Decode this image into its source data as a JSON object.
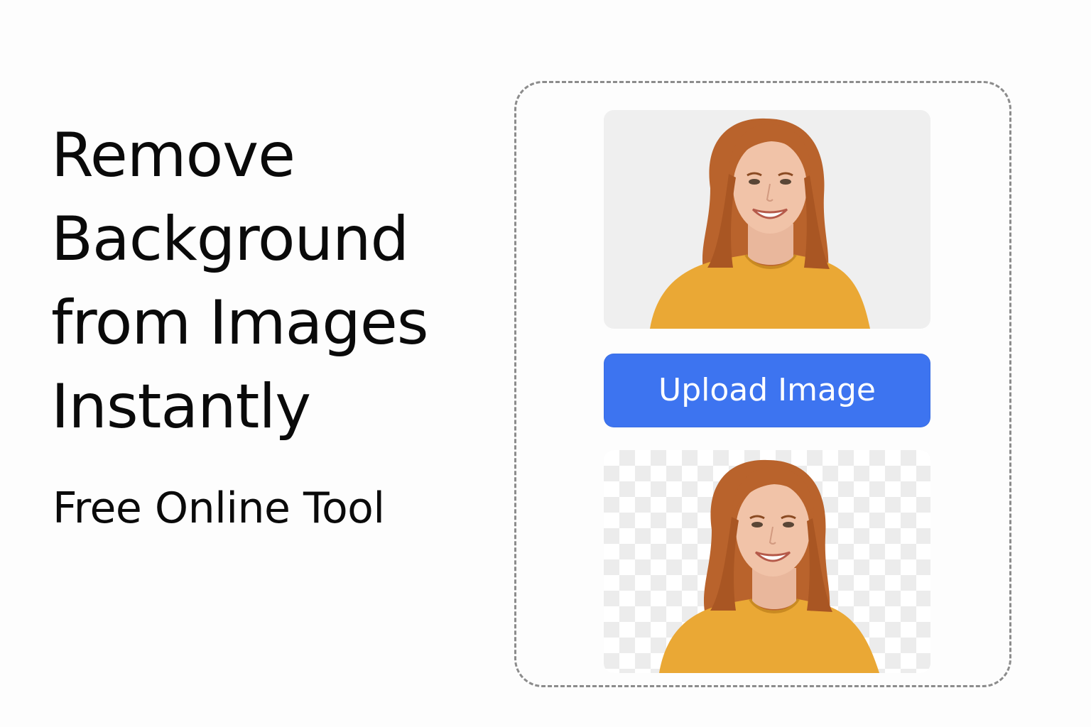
{
  "hero": {
    "title_lines": [
      "Remove",
      "Background",
      "from Images",
      "Instantly"
    ],
    "subtitle": "Free Online Tool"
  },
  "uploader": {
    "button_label": "Upload Image",
    "accent_color": "#3d74f0",
    "original_preview_bg": "#efefef",
    "result_preview_bg": "transparent-checkerboard"
  }
}
